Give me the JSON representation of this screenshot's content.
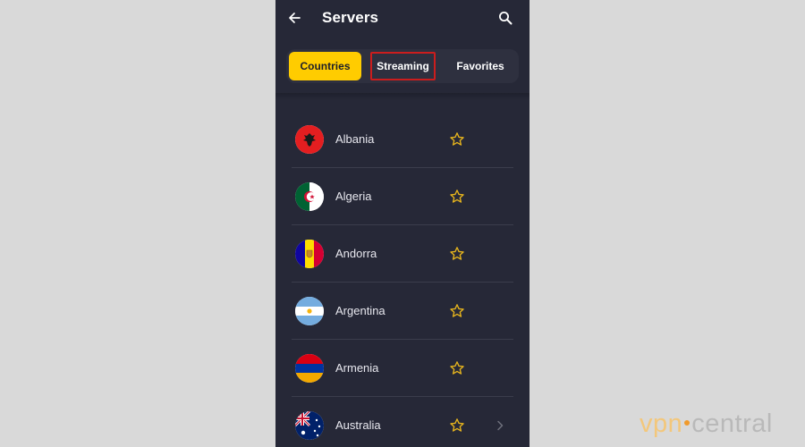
{
  "header": {
    "title": "Servers",
    "back_icon": "arrow-left-icon",
    "search_icon": "search-icon"
  },
  "tabs": [
    {
      "label": "Countries",
      "state": "active"
    },
    {
      "label": "Streaming",
      "state": "highlighted"
    },
    {
      "label": "Favorites",
      "state": "normal"
    }
  ],
  "countries": [
    {
      "name": "Albania",
      "flag_icon": "albania-flag-icon",
      "favorite": false
    },
    {
      "name": "Algeria",
      "flag_icon": "algeria-flag-icon",
      "favorite": false
    },
    {
      "name": "Andorra",
      "flag_icon": "andorra-flag-icon",
      "favorite": false
    },
    {
      "name": "Argentina",
      "flag_icon": "argentina-flag-icon",
      "favorite": false
    },
    {
      "name": "Armenia",
      "flag_icon": "armenia-flag-icon",
      "favorite": false
    },
    {
      "name": "Australia",
      "flag_icon": "australia-flag-icon",
      "favorite": false,
      "expandable": true
    }
  ],
  "watermark": {
    "part1": "vpn",
    "part2": "central"
  },
  "colors": {
    "background": "#d9d9d9",
    "app_background": "#262837",
    "accent": "#ffcc00",
    "highlight_border": "#cc1d1d",
    "star": "#e7b51d"
  }
}
